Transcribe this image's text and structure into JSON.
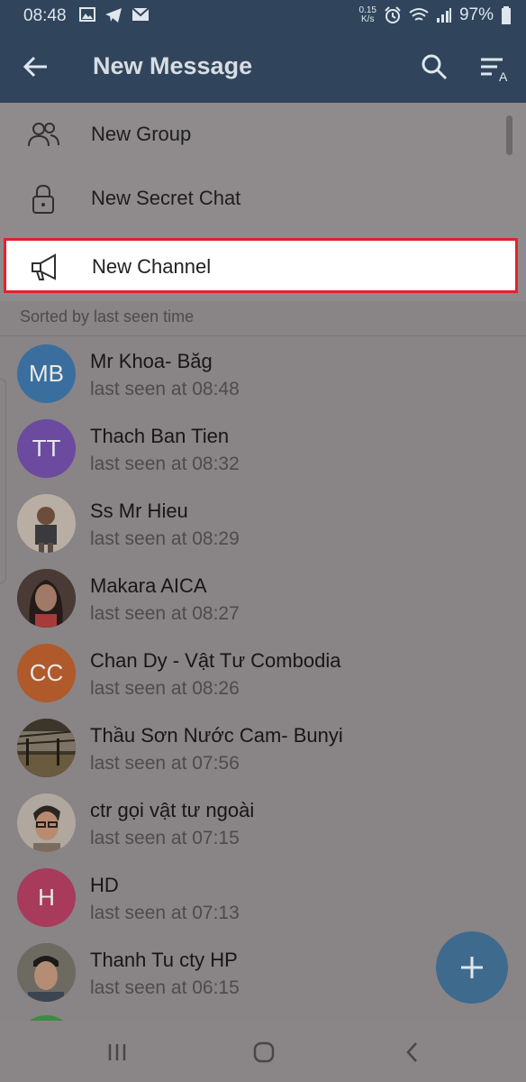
{
  "status_bar": {
    "time": "08:48",
    "net_speed_value": "0.15",
    "net_speed_unit": "K/s",
    "battery": "97%"
  },
  "header": {
    "title": "New Message"
  },
  "menu": {
    "items": [
      {
        "label": "New Group",
        "icon": "group-icon"
      },
      {
        "label": "New Secret Chat",
        "icon": "lock-icon"
      },
      {
        "label": "New Channel",
        "icon": "megaphone-icon",
        "highlighted": true
      }
    ]
  },
  "section": {
    "label": "Sorted by last seen time"
  },
  "contacts": [
    {
      "name": "Mr Khoa- Băg",
      "seen": "last seen at 08:48",
      "initials": "MB",
      "avatar_color": "#3a6e9e"
    },
    {
      "name": "Thach Ban Tien",
      "seen": "last seen at 08:32",
      "initials": "TT",
      "avatar_color": "#6b4aa0"
    },
    {
      "name": "Ss Mr Hieu",
      "seen": "last seen at 08:29",
      "initials": "",
      "avatar_color": "#a59c93"
    },
    {
      "name": "Makara AICA",
      "seen": "last seen at 08:27",
      "initials": "",
      "avatar_color": "#4a3a35"
    },
    {
      "name": "Chan Dy - Vật Tư Combodia",
      "seen": "last seen at 08:26",
      "initials": "CC",
      "avatar_color": "#b0592b"
    },
    {
      "name": "Thầu Sơn Nước Cam- Bunyi",
      "seen": "last seen at 07:56",
      "initials": "",
      "avatar_color": "#4e4637"
    },
    {
      "name": "ctr gọi vật tư ngoài",
      "seen": "last seen at 07:15",
      "initials": "",
      "avatar_color": "#9a8e84"
    },
    {
      "name": "HD",
      "seen": "last seen at 07:13",
      "initials": "H",
      "avatar_color": "#a83a5c"
    },
    {
      "name": "Thanh Tu cty HP",
      "seen": "last seen at 06:15",
      "initials": "",
      "avatar_color": "#6d6a62"
    }
  ],
  "colors": {
    "toolbar": "#30455b",
    "highlight_border": "#e0232a",
    "fab": "#3e6a8d",
    "overlay_background": "#898486"
  }
}
